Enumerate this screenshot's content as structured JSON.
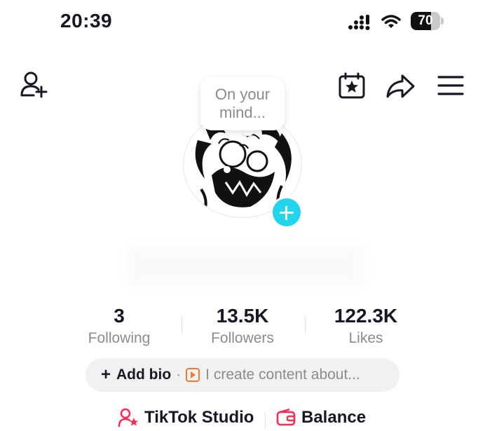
{
  "status_bar": {
    "time": "20:39",
    "battery_level": "70",
    "battery_fraction": 0.7
  },
  "header": {
    "icons": [
      "add-friend-icon",
      "calendar-star-icon",
      "share-icon",
      "menu-icon"
    ]
  },
  "profile": {
    "thought_bubble": "On your\nmind..."
  },
  "stats": {
    "following": {
      "value": "3",
      "label": "Following"
    },
    "followers": {
      "value": "13.5K",
      "label": "Followers"
    },
    "likes": {
      "value": "122.3K",
      "label": "Likes"
    }
  },
  "bio": {
    "plus": "+",
    "add_label": "Add bio",
    "separator": "·",
    "placeholder": "I create content about..."
  },
  "links": {
    "studio_label": "TikTok Studio",
    "balance_label": "Balance"
  },
  "colors": {
    "accent_cyan": "#20d5ec",
    "brand_pink": "#fe2c55",
    "bio_orange": "#f07a32",
    "text_primary": "#161823",
    "text_secondary": "#8a8b91"
  }
}
